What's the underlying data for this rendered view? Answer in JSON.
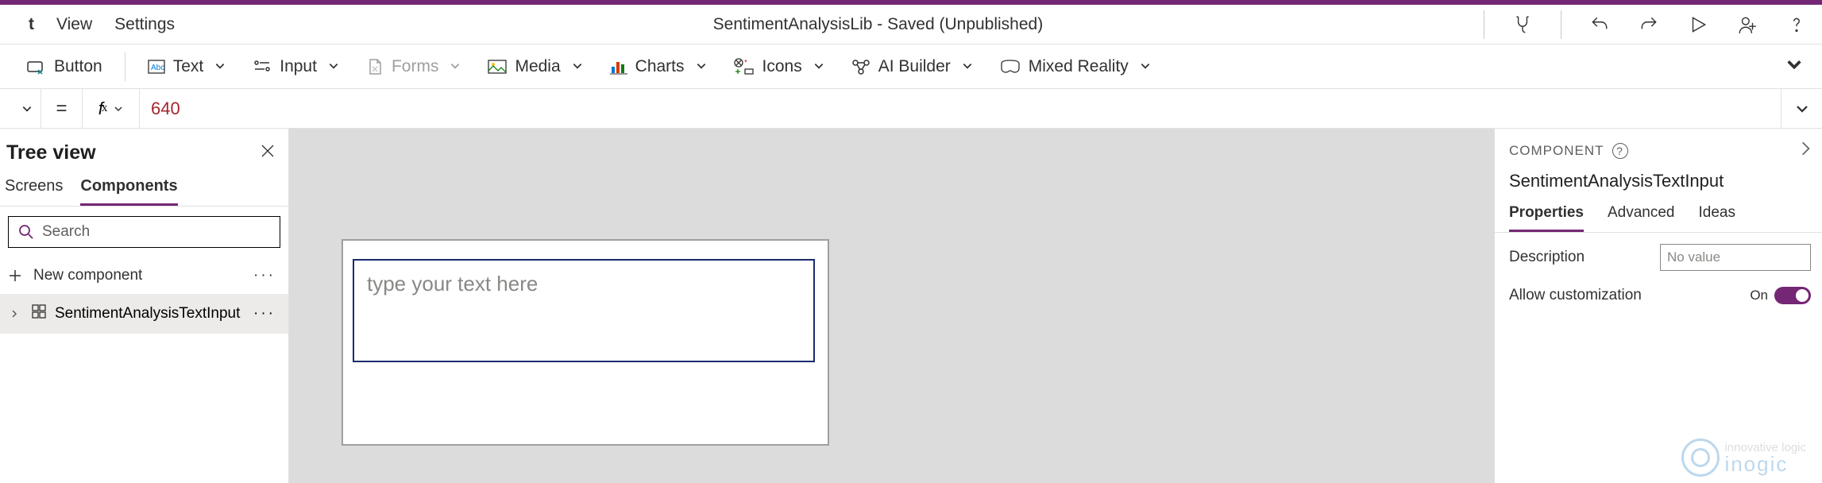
{
  "menubar": {
    "items": [
      "t",
      "View",
      "Settings"
    ],
    "title": "SentimentAnalysisLib - Saved (Unpublished)"
  },
  "ribbon": {
    "button": "Button",
    "text": "Text",
    "input": "Input",
    "forms": "Forms",
    "media": "Media",
    "charts": "Charts",
    "icons": "Icons",
    "aibuilder": "AI Builder",
    "mr": "Mixed Reality"
  },
  "formula": {
    "eq": "=",
    "fx_f": "f",
    "fx_x": "x",
    "value": "640"
  },
  "tree": {
    "title": "Tree view",
    "tabs": {
      "screens": "Screens",
      "components": "Components"
    },
    "search_placeholder": "Search",
    "new_component": "New component",
    "node": "SentimentAnalysisTextInput"
  },
  "canvas": {
    "placeholder": "type your text here"
  },
  "properties": {
    "header": "Component",
    "name": "SentimentAnalysisTextInput",
    "tabs": {
      "properties": "Properties",
      "advanced": "Advanced",
      "ideas": "Ideas"
    },
    "description_label": "Description",
    "description_value": "No value",
    "allow_label": "Allow customization",
    "toggle_text": "On"
  },
  "watermark": {
    "line1": "innovative logic",
    "line2": "inogic"
  }
}
